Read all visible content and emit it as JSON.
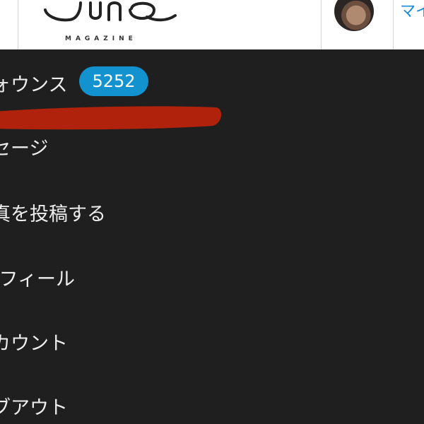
{
  "header": {
    "logo_subtitle": "MAGAZINE",
    "my_link_label": "マイ"
  },
  "menu": {
    "items": [
      {
        "label": "ォウンス",
        "badge": "5252"
      },
      {
        "label": "セージ"
      },
      {
        "label": "真を投稿する"
      },
      {
        "label": "]フィール"
      },
      {
        "label": "カウント"
      },
      {
        "label": "ブアウト"
      }
    ]
  },
  "colors": {
    "header_bg": "#ffffff",
    "menu_bg": "#1f1f1f",
    "menu_text": "#ededed",
    "badge_bg": "#1293cf",
    "link_blue": "#1a8ad6",
    "redaction_red": "#b0220c"
  }
}
